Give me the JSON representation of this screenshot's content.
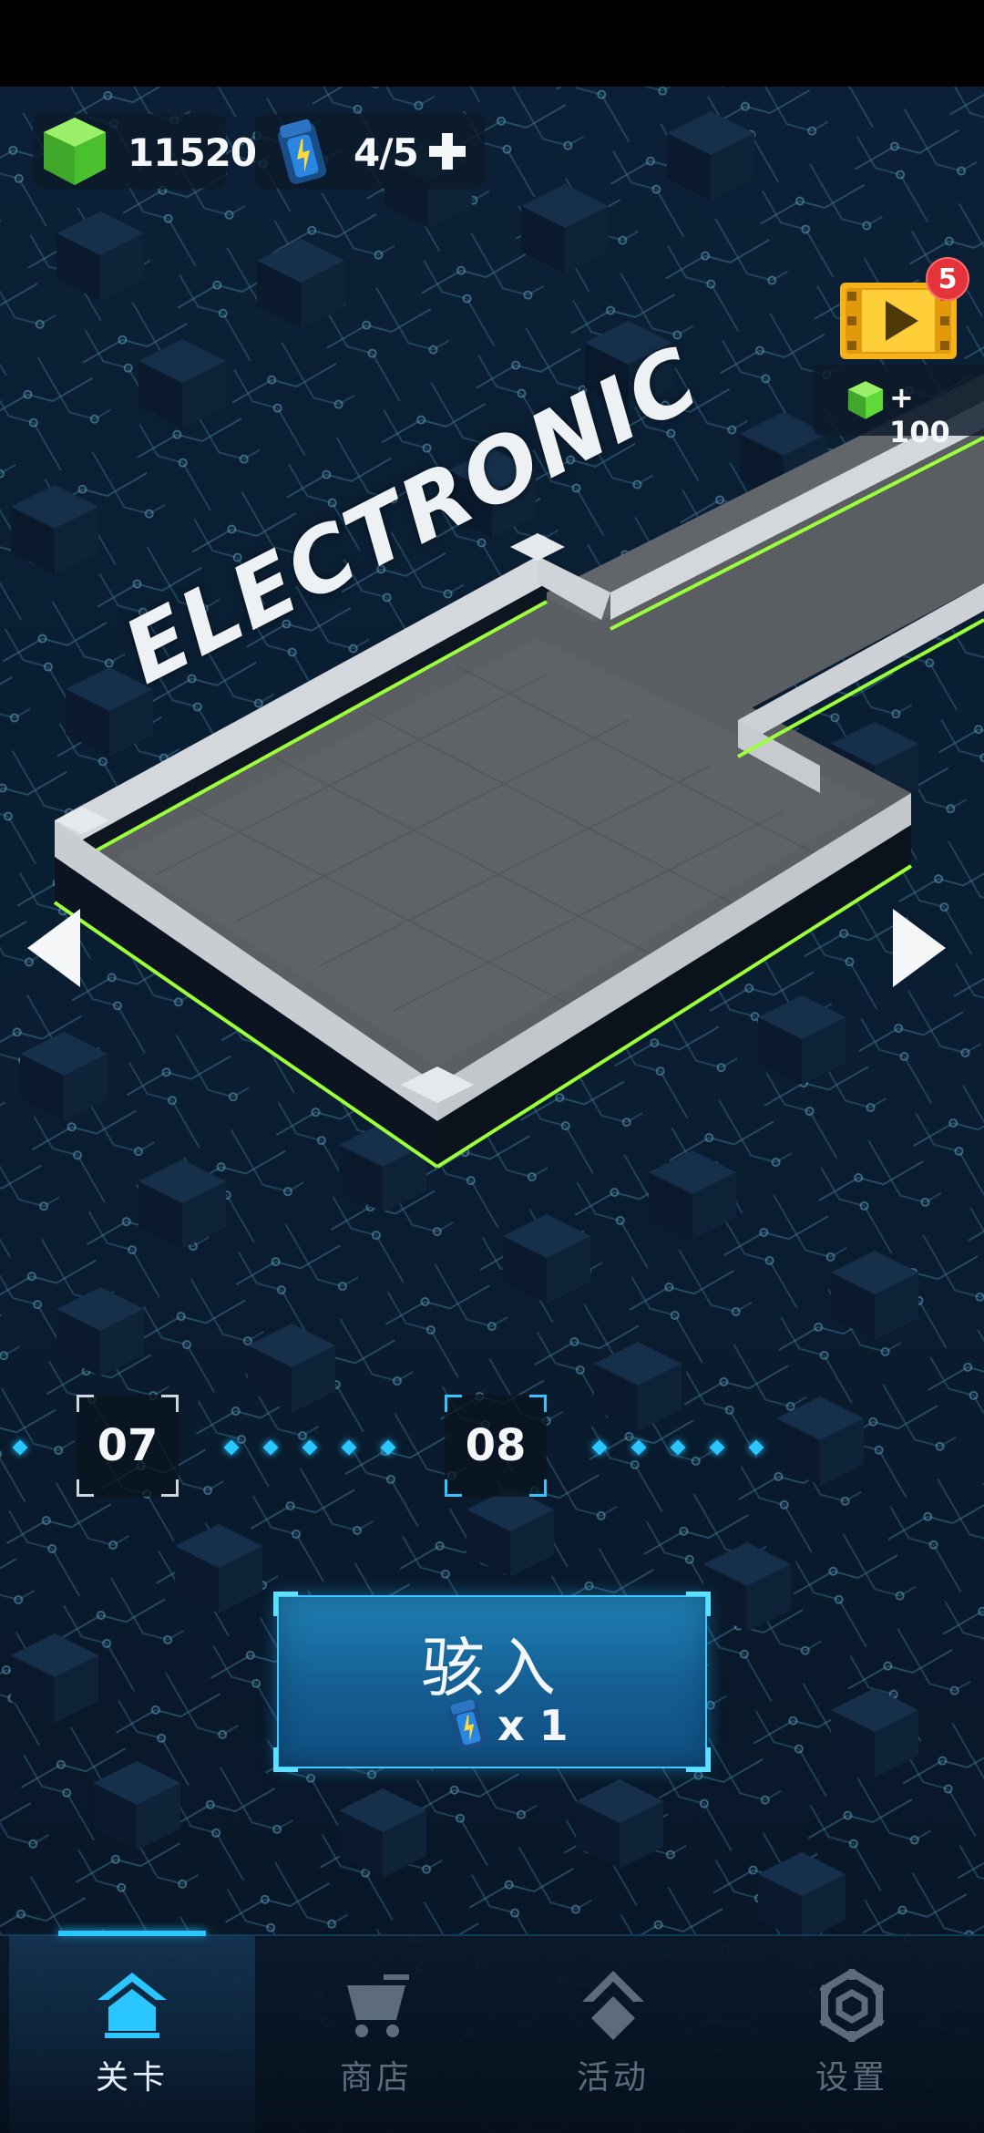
{
  "resources": {
    "gems": "11520",
    "energy": "4/5"
  },
  "reward": {
    "badge_count": "5",
    "label": "+ 100"
  },
  "zone": {
    "title": "ELECTRONIC"
  },
  "levels": [
    {
      "label": "07",
      "selected": false
    },
    {
      "label": "08",
      "selected": true
    }
  ],
  "enter": {
    "label": "骇入",
    "cost": "x 1"
  },
  "nav": {
    "items": [
      {
        "label": "关卡",
        "icon": "home-icon",
        "active": true
      },
      {
        "label": "商店",
        "icon": "cart-icon",
        "active": false
      },
      {
        "label": "活动",
        "icon": "event-icon",
        "active": false
      },
      {
        "label": "设置",
        "icon": "gear-icon",
        "active": false
      }
    ]
  },
  "colors": {
    "accent": "#2ac6ff",
    "gem": "#5fd83a",
    "badge": "#e5333c",
    "wall_glow": "#9bff3a"
  }
}
